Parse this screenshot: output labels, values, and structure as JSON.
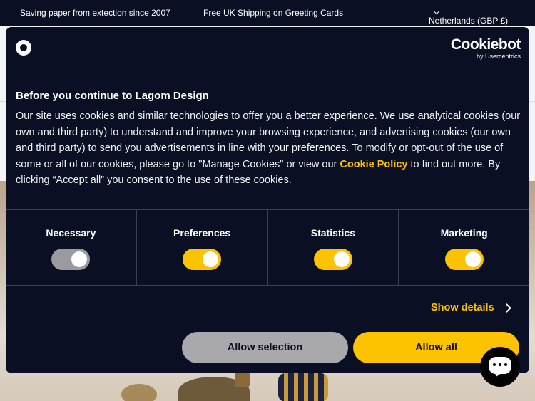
{
  "announcement": {
    "left": "Saving paper from extection since 2007",
    "center": "Free UK Shipping on Greeting Cards",
    "region": "Netherlands (GBP £)"
  },
  "cookie_dialog": {
    "brand": "Cookiebot",
    "brand_sub": "by Usercentrics",
    "title": "Before you continue to Lagom Design",
    "body_1": "Our site uses cookies and similar technologies to offer you a better experience. We use analytical cookies (our own and third party) to understand and improve your browsing experience, and advertising cookies (our own and third party) to send you advertisements in line with your preferences. To modify or opt-out of the use of some or all of our cookies, please go to \"Manage Cookies\" or view our ",
    "policy_link": "Cookie Policy",
    "body_2": " to find out more. By clicking “Accept all” you consent to the use of these cookies.",
    "categories": [
      {
        "label": "Necessary",
        "enabled": true,
        "locked": true
      },
      {
        "label": "Preferences",
        "enabled": true,
        "locked": false
      },
      {
        "label": "Statistics",
        "enabled": true,
        "locked": false
      },
      {
        "label": "Marketing",
        "enabled": true,
        "locked": false
      }
    ],
    "show_details": "Show details",
    "allow_selection": "Allow selection",
    "allow_all": "Allow all",
    "colors": {
      "accent": "#fdc300",
      "panel": "#0b0f24",
      "disabled_toggle": "#9a9a9f"
    }
  },
  "icons": {
    "region_chevron": "chevron-down-icon",
    "details_chevron": "chevron-right-icon",
    "chat": "chat-icon",
    "logo": "cookiebot-logo-icon"
  }
}
